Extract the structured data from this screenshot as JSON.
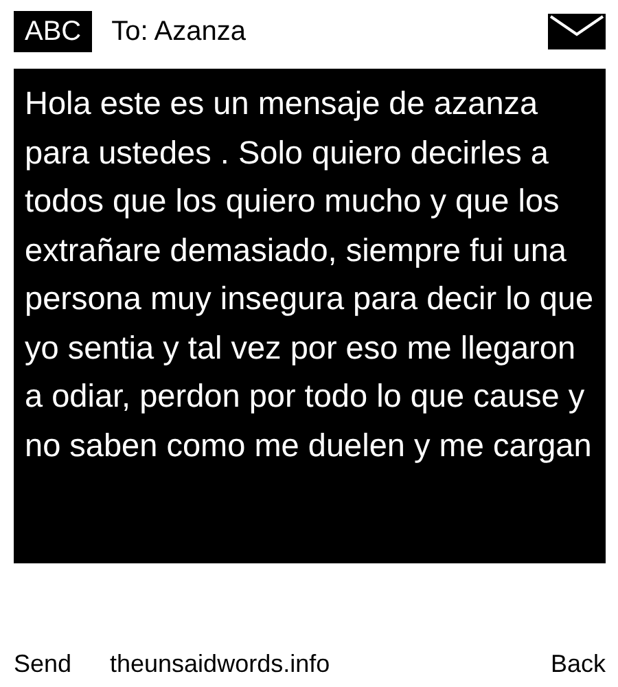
{
  "header": {
    "badge": "ABC",
    "recipient": "To: Azanza"
  },
  "message": "Hola este es un mensaje de azanza para ustedes . Solo quiero decirles a todos que los quiero mucho y que los extrañare demasiado, siempre fui una persona muy insegura para decir lo que yo sentia y tal vez por eso me llegaron a odiar, perdon por todo lo que cause y no saben como me duelen y me cargan",
  "footer": {
    "left": "Send",
    "center": "theunsaidwords.info",
    "right": "Back"
  }
}
